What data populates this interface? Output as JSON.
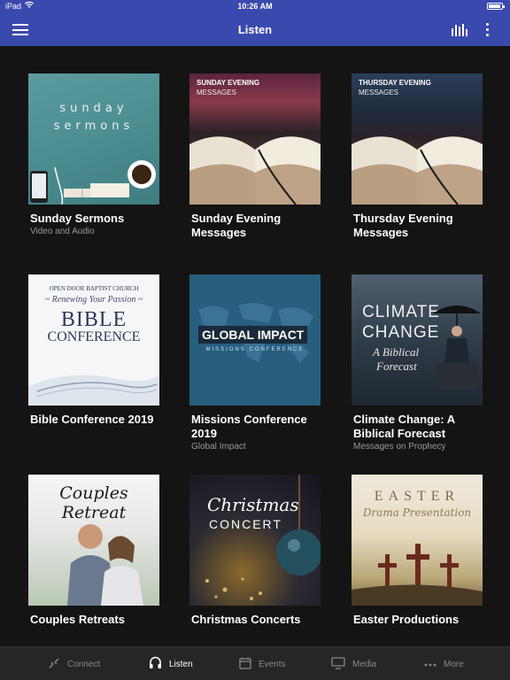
{
  "status": {
    "carrier": "iPad",
    "time": "10:26 AM"
  },
  "header": {
    "title": "Listen"
  },
  "items": [
    {
      "title": "Sunday Sermons",
      "subtitle": "Video and Audio",
      "art_text": [
        "sunday",
        "sermons"
      ]
    },
    {
      "title": "Sunday Evening Messages",
      "subtitle": "",
      "art_text": [
        "SUNDAY EVENING",
        "MESSAGES"
      ]
    },
    {
      "title": "Thursday Evening Messages",
      "subtitle": "",
      "art_text": [
        "THURSDAY EVENING",
        "MESSAGES"
      ]
    },
    {
      "title": "Bible Conference 2019",
      "subtitle": "",
      "art_text": [
        "OPEN DOOR BAPTIST CHURCH",
        "~ Renewing Your Passion ~",
        "BIBLE",
        "CONFERENCE"
      ]
    },
    {
      "title": "Missions Conference 2019",
      "subtitle": "Global Impact",
      "art_text": [
        "GLOBAL IMPACT",
        "MISSIONS CONFERENCE"
      ]
    },
    {
      "title": "Climate Change: A Biblical Forecast",
      "subtitle": "Messages on Prophecy",
      "art_text": [
        "CLIMATE",
        "CHANGE",
        "A Biblical",
        "Forecast"
      ]
    },
    {
      "title": "Couples Retreats",
      "subtitle": "",
      "art_text": [
        "Couples Retreat"
      ]
    },
    {
      "title": "Christmas Concerts",
      "subtitle": "",
      "art_text": [
        "Christmas",
        "CONCERT"
      ]
    },
    {
      "title": "Easter Productions",
      "subtitle": "",
      "art_text": [
        "EASTER",
        "Drama Presentation"
      ]
    }
  ],
  "tabs": [
    {
      "label": "Connect",
      "icon": "connect-icon"
    },
    {
      "label": "Listen",
      "icon": "headphones-icon"
    },
    {
      "label": "Events",
      "icon": "calendar-icon"
    },
    {
      "label": "Media",
      "icon": "monitor-icon"
    },
    {
      "label": "More",
      "icon": "ellipsis-icon"
    }
  ],
  "colors": {
    "header": "#3a49ad",
    "background": "#141414",
    "tabbar": "#262626",
    "active_tab": "#ffffff",
    "inactive_tab": "#8a8a8a"
  }
}
